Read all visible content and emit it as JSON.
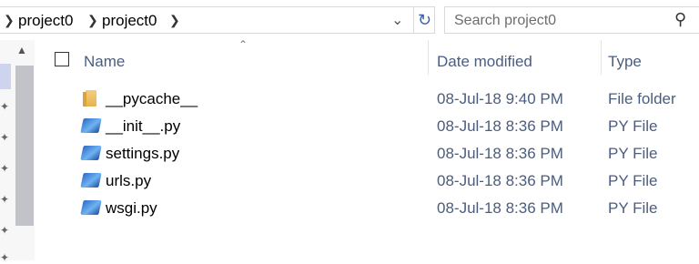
{
  "address_bar": {
    "crumbs": [
      "project0",
      "project0"
    ]
  },
  "search": {
    "placeholder": "Search project0"
  },
  "columns": {
    "name": "Name",
    "date_modified": "Date modified",
    "type": "Type"
  },
  "files": [
    {
      "name": "__pycache__",
      "date": "08-Jul-18 9:40 PM",
      "type": "File folder",
      "icon": "folder-icon"
    },
    {
      "name": "__init__.py",
      "date": "08-Jul-18 8:36 PM",
      "type": "PY File",
      "icon": "python-file-icon"
    },
    {
      "name": "settings.py",
      "date": "08-Jul-18 8:36 PM",
      "type": "PY File",
      "icon": "python-file-icon"
    },
    {
      "name": "urls.py",
      "date": "08-Jul-18 8:36 PM",
      "type": "PY File",
      "icon": "python-file-icon"
    },
    {
      "name": "wsgi.py",
      "date": "08-Jul-18 8:36 PM",
      "type": "PY File",
      "icon": "python-file-icon"
    }
  ],
  "colors": {
    "header_text": "#4a5d80",
    "nav_scroll_thumb": "#c2c3c9",
    "folder": "#e8b350"
  }
}
